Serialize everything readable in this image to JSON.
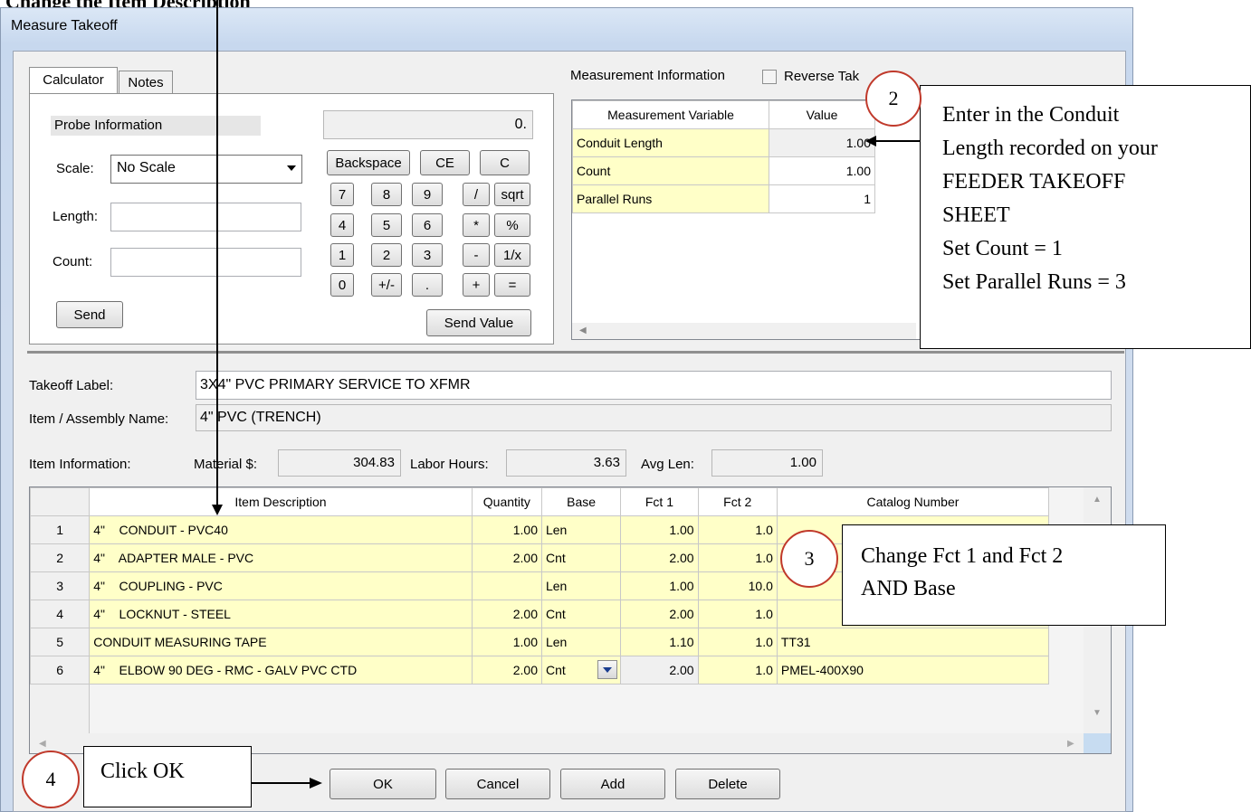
{
  "heading_top": "Change the Item Description",
  "window": {
    "title": "Measure Takeoff"
  },
  "tabs": [
    "Calculator",
    "Notes"
  ],
  "calculator": {
    "probe_label": "Probe Information",
    "scale_label": "Scale:",
    "scale_value": "No Scale",
    "length_label": "Length:",
    "count_label": "Count:",
    "send_label": "Send",
    "display": "0.",
    "send_value_label": "Send Value",
    "keys": {
      "backspace": "Backspace",
      "ce": "CE",
      "c": "C",
      "k7": "7",
      "k8": "8",
      "k9": "9",
      "div": "/",
      "sqrt": "sqrt",
      "k4": "4",
      "k5": "5",
      "k6": "6",
      "mul": "*",
      "pct": "%",
      "k1": "1",
      "k2": "2",
      "k3": "3",
      "sub": "-",
      "inv": "1/x",
      "k0": "0",
      "sign": "+/-",
      "dot": ".",
      "add": "+",
      "eq": "="
    }
  },
  "measurement": {
    "label": "Measurement Information",
    "reverse_label": "Reverse Tak",
    "headers": [
      "Measurement Variable",
      "Value"
    ],
    "rows": [
      {
        "name": "Conduit Length",
        "value": "1.00"
      },
      {
        "name": "Count",
        "value": "1.00"
      },
      {
        "name": "Parallel Runs",
        "value": "1"
      }
    ]
  },
  "takeoff": {
    "label_caption": "Takeoff Label:",
    "label_value": "3X4\" PVC PRIMARY SERVICE TO XFMR",
    "item_caption": "Item / Assembly Name:",
    "item_value": "4\" PVC (TRENCH)",
    "info_caption": "Item Information:",
    "material_caption": "Material $:",
    "material_value": "304.83",
    "labor_caption": "Labor Hours:",
    "labor_value": "3.63",
    "avglen_caption": "Avg Len:",
    "avglen_value": "1.00"
  },
  "items": {
    "headers": [
      "",
      "Item Description",
      "Quantity",
      "Base",
      "Fct 1",
      "Fct 2",
      "Catalog Number"
    ],
    "rows": [
      {
        "no": "1",
        "desc": "4\"    CONDUIT - PVC40",
        "qty": "1.00",
        "base": "Len",
        "f1": "1.00",
        "f2": "1.0",
        "cat": ""
      },
      {
        "no": "2",
        "desc": "4\"    ADAPTER MALE - PVC",
        "qty": "2.00",
        "base": "Cnt",
        "f1": "2.00",
        "f2": "1.0",
        "cat": ""
      },
      {
        "no": "3",
        "desc": "4\"    COUPLING - PVC",
        "qty": "",
        "base": "Len",
        "f1": "1.00",
        "f2": "10.0",
        "cat": ""
      },
      {
        "no": "4",
        "desc": "4\"    LOCKNUT - STEEL",
        "qty": "2.00",
        "base": "Cnt",
        "f1": "2.00",
        "f2": "1.0",
        "cat": ""
      },
      {
        "no": "5",
        "desc": "CONDUIT MEASURING TAPE",
        "qty": "1.00",
        "base": "Len",
        "f1": "1.10",
        "f2": "1.0",
        "cat": "TT31"
      },
      {
        "no": "6",
        "desc": "4\"    ELBOW 90 DEG - RMC - GALV PVC CTD",
        "qty": "2.00",
        "base": "Cnt",
        "f1": "2.00",
        "f2": "1.0",
        "cat": "PMEL-400X90"
      }
    ]
  },
  "buttons": {
    "ok": "OK",
    "cancel": "Cancel",
    "add": "Add",
    "delete": "Delete"
  },
  "callouts": {
    "c2_num": "2",
    "c2_lines": [
      "Enter in the Conduit",
      "Length recorded on your",
      "FEEDER TAKEOFF",
      "SHEET",
      "Set Count = 1",
      "Set Parallel Runs = 3"
    ],
    "c3_num": "3",
    "c3_lines": [
      "Change Fct 1 and Fct 2",
      "AND Base"
    ],
    "c4_num": "4",
    "c4_text": "Click OK"
  }
}
